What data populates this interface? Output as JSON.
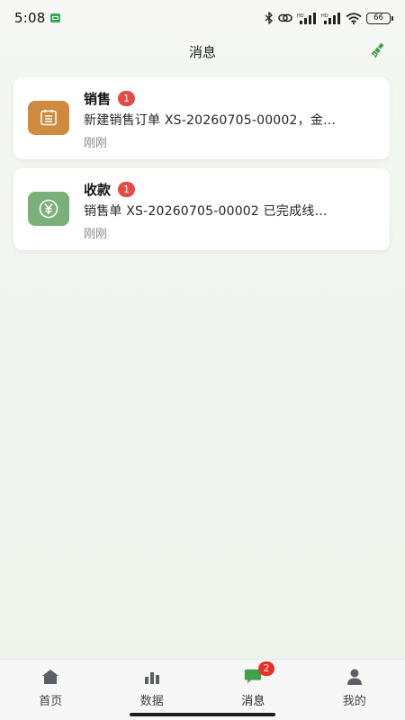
{
  "status_bar": {
    "time": "5:08",
    "battery": "66"
  },
  "header": {
    "title": "消息"
  },
  "messages": [
    {
      "title": "销售",
      "badge": "1",
      "summary": "新建销售订单 XS-20260705-00002，金…",
      "time": "刚刚",
      "icon": "document-icon",
      "icon_color": "#d08a3e"
    },
    {
      "title": "收款",
      "badge": "1",
      "summary": "销售单 XS-20260705-00002 已完成线…",
      "time": "刚刚",
      "icon": "yen-icon",
      "icon_color": "#7cb07a"
    }
  ],
  "tabbar": {
    "items": [
      {
        "label": "首页",
        "icon": "home-icon"
      },
      {
        "label": "数据",
        "icon": "bar-chart-icon"
      },
      {
        "label": "消息",
        "icon": "chat-icon",
        "badge": "2",
        "active": true
      },
      {
        "label": "我的",
        "icon": "user-icon"
      }
    ]
  },
  "colors": {
    "accent_green": "#3fa24a",
    "badge_red": "#e34b43"
  }
}
